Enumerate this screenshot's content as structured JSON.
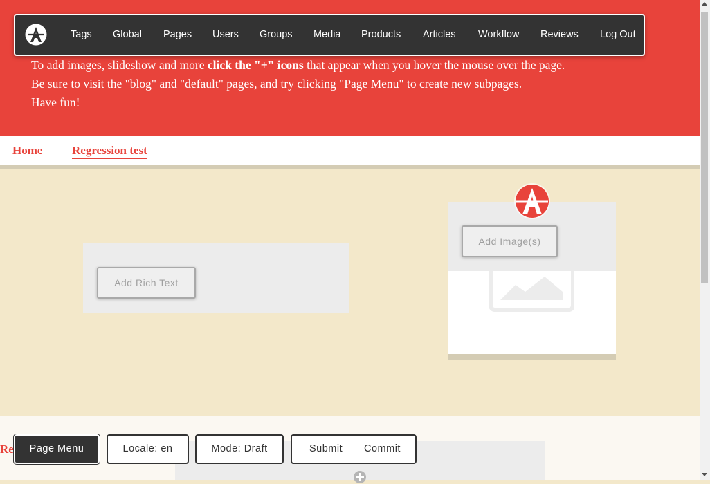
{
  "admin_bar": {
    "logo_icon": "apostrophe-logo-icon",
    "items": [
      "Tags",
      "Global",
      "Pages",
      "Users",
      "Groups",
      "Media",
      "Products",
      "Articles",
      "Workflow",
      "Reviews",
      "Log Out"
    ]
  },
  "hero": {
    "line1_pre": "To add images, slideshow and more ",
    "line1_bold": "click the \"+\" icons",
    "line1_post": " that appear when you hover the mouse over the page.",
    "line2": "Be sure to visit the \"blog\" and \"default\" pages, and try clicking \"Page Menu\" to create new subpages.",
    "line3": "Have fun!"
  },
  "nav": {
    "home": "Home",
    "regression": "Regression test"
  },
  "widgets": {
    "add_rich_text": "Add Rich Text",
    "add_images": "Add Image(s)"
  },
  "lower": {
    "fragment": "Re"
  },
  "toolbar": {
    "page_menu": "Page Menu",
    "locale": "Locale: en",
    "mode": "Mode: Draft",
    "submit": "Submit",
    "commit": "Commit"
  },
  "colors": {
    "brand_red": "#e8433b",
    "admin_dark": "#333333",
    "content_bg": "#f3e8ca"
  }
}
